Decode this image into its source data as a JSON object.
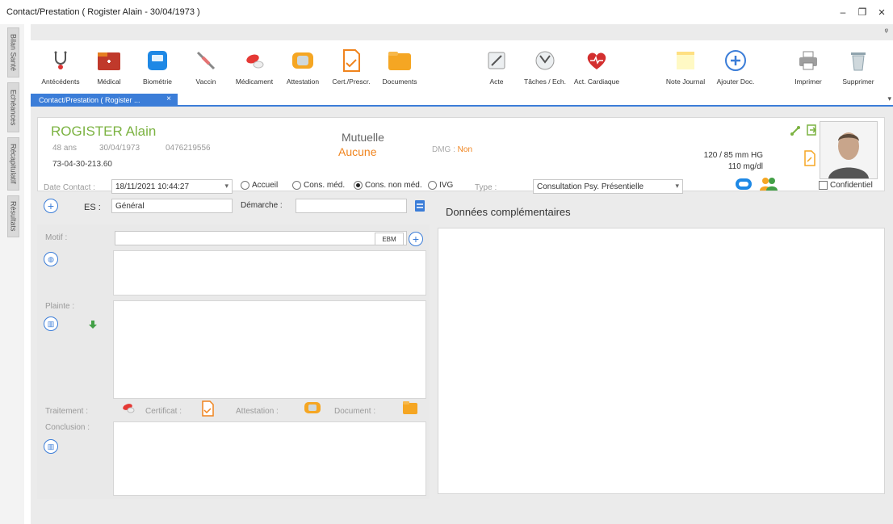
{
  "window": {
    "title": "Contact/Prestation ( Rogister Alain - 30/04/1973 )",
    "minimize_glyph": "–",
    "restore_glyph": "❐",
    "close_glyph": "×",
    "pin_glyph": "ᵠ"
  },
  "side_tabs": [
    "Bilan Santé",
    "Echéances",
    "Récapitulatif",
    "Résultats"
  ],
  "toolbar": [
    {
      "label": "Antécédents",
      "icon": "stethoscope-icon"
    },
    {
      "label": "Médical",
      "icon": "medical-folder-icon"
    },
    {
      "label": "Biométrie",
      "icon": "scale-icon"
    },
    {
      "label": "Vaccin",
      "icon": "syringe-icon"
    },
    {
      "label": "Médicament",
      "icon": "pills-icon"
    },
    {
      "label": "Attestation",
      "icon": "certificate-icon"
    },
    {
      "label": "Cert./Prescr.",
      "icon": "prescription-icon"
    },
    {
      "label": "Documents",
      "icon": "documents-folder-icon"
    },
    {
      "label": "Acte",
      "icon": "act-icon"
    },
    {
      "label": "Tâches / Ech.",
      "icon": "tasks-icon"
    },
    {
      "label": "Act. Cardiaque",
      "icon": "heart-icon"
    },
    {
      "label": "Note Journal",
      "icon": "note-icon"
    },
    {
      "label": "Ajouter Doc.",
      "icon": "add-doc-icon"
    },
    {
      "label": "Imprimer",
      "icon": "printer-icon"
    },
    {
      "label": "Supprimer",
      "icon": "trash-icon"
    }
  ],
  "doc_tab": {
    "label": "Contact/Prestation ( Rogister ...",
    "close": "×",
    "menu_glyph": "▾"
  },
  "patient": {
    "name": "ROGISTER Alain",
    "age": "48 ans",
    "birthdate": "30/04/1973",
    "phone": "0476219556",
    "national_number": "73-04-30-213.60",
    "mutuelle_label": "Mutuelle",
    "mutuelle_value": "Aucune",
    "dmg_label": "DMG :",
    "dmg_value": "Non",
    "blood_pressure": "120 / 85 mm HG",
    "glycemia": "110 mg/dl"
  },
  "form": {
    "date_label": "Date Contact :",
    "date_value": "18/11/2021 10:44:27",
    "radios": [
      {
        "label": "Accueil",
        "checked": false
      },
      {
        "label": "Cons. méd.",
        "checked": false
      },
      {
        "label": "Cons. non méd.",
        "checked": true
      },
      {
        "label": "IVG",
        "checked": false
      }
    ],
    "type_label": "Type :",
    "type_value": "Consultation Psy. Présentielle",
    "confidential_label": "Confidentiel",
    "es_label": "ES :",
    "es_value": "Général",
    "demarche_label": "Démarche :",
    "demarche_value": "",
    "donnees_label": "Données complémentaires",
    "motif_label": "Motif :",
    "ebm_label": "EBM",
    "plainte_label": "Plainte :",
    "traitement_label": "Traitement :",
    "certificat_label": "Certificat :",
    "attestation_label": "Attestation :",
    "document_label": "Document :",
    "conclusion_label": "Conclusion :"
  },
  "colors": {
    "accent": "#3b7dd8",
    "name": "#7cb342",
    "orange": "#f0841e"
  }
}
